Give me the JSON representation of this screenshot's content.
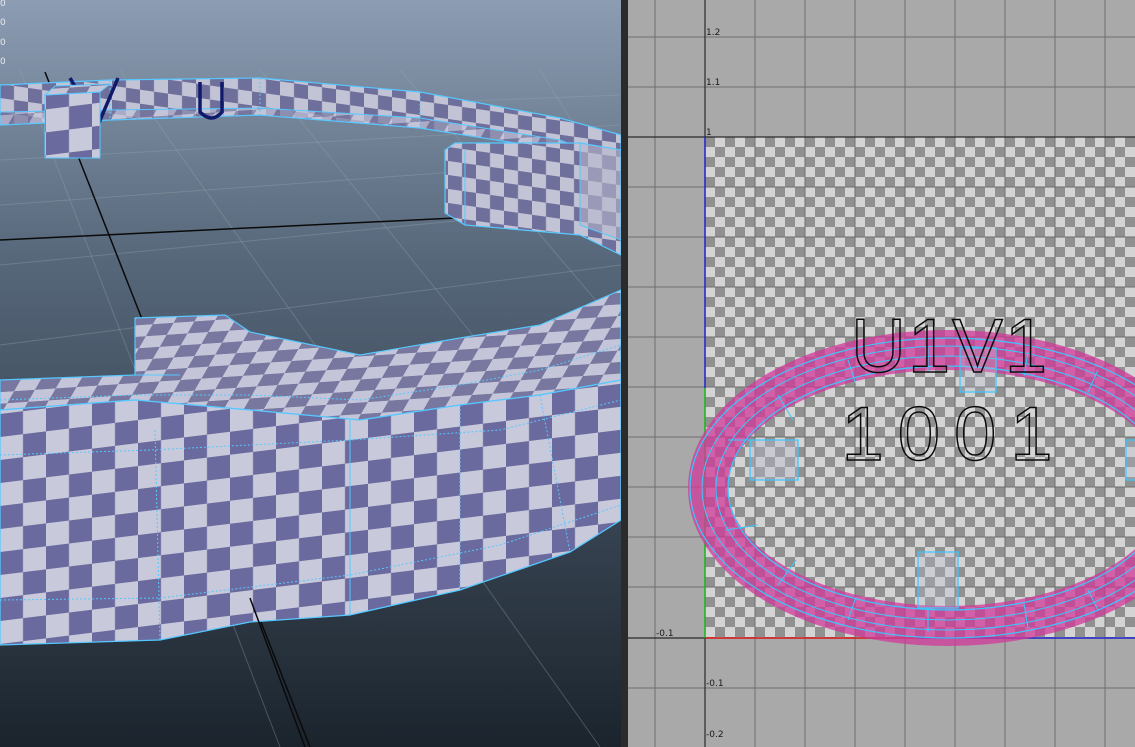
{
  "viewport": {
    "hud_values": [
      "0",
      "0",
      "0",
      "0"
    ],
    "colors": {
      "sky_top": "#8a9bb0",
      "sky_bottom": "#1c2630",
      "wire": "#56c8ff",
      "check_dark": "#6a6a9e",
      "check_light": "#c9c9dc"
    }
  },
  "uv_editor": {
    "u_axis_labels": [
      "-0.1"
    ],
    "v_axis_labels": [
      "1.2",
      "1.1",
      "1",
      "-0.1",
      "-0.2"
    ],
    "tile_label_primary": "U1V1",
    "tile_label_secondary": "1001",
    "colors": {
      "background": "#a9a9a9",
      "grid": "#7a7a7a",
      "uv_shell": "#d23a9a",
      "uv_wire": "#3ac8ff",
      "u_axis": "#e02020",
      "v_axis": "#2a2ad8",
      "v_axis_low": "#20c020"
    }
  }
}
